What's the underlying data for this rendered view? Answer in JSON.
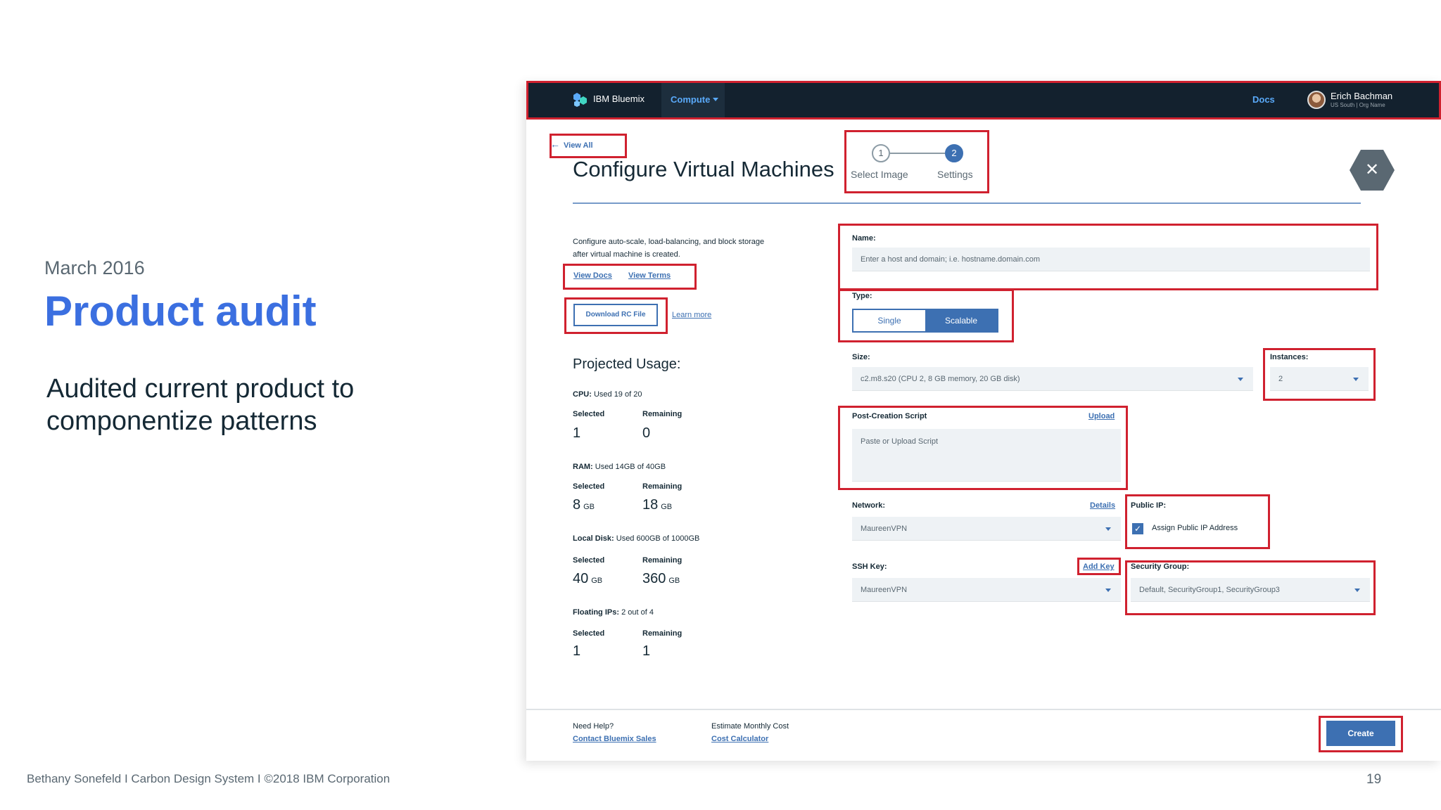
{
  "slide": {
    "date": "March 2016",
    "title": "Product audit",
    "description": "Audited current product to componentize patterns",
    "footer": "Bethany Sonefeld  I  Carbon Design System I  ©2018 IBM Corporation",
    "page_number": "19"
  },
  "topnav": {
    "brand": "IBM Bluemix",
    "menu": "Compute",
    "docs": "Docs",
    "user_name": "Erich Bachman",
    "user_sub": "US South | Org Name"
  },
  "page": {
    "view_all": "View All",
    "title": "Configure Virtual Machines",
    "steps": [
      {
        "number": "1",
        "label": "Select Image"
      },
      {
        "number": "2",
        "label": "Settings"
      }
    ],
    "close_icon": "close-icon"
  },
  "left_panel": {
    "intro": "Configure auto-scale, load-balancing, and block storage after virtual machine is created.",
    "view_docs": "View Docs",
    "view_terms": "View Terms",
    "download_rc": "Download RC File",
    "learn_more": "Learn more",
    "usage_title": "Projected Usage:",
    "col_selected": "Selected",
    "col_remaining": "Remaining",
    "cpu": {
      "label": "CPU:",
      "detail": "Used 19 of 20",
      "selected": "1",
      "remaining": "0",
      "unit": ""
    },
    "ram": {
      "label": "RAM:",
      "detail": "Used 14GB of 40GB",
      "selected": "8",
      "remaining": "18",
      "unit": "GB"
    },
    "disk": {
      "label": "Local Disk:",
      "detail": "Used 600GB of 1000GB",
      "selected": "40",
      "remaining": "360",
      "unit": "GB"
    },
    "ips": {
      "label": "Floating IPs:",
      "detail": "2 out of 4",
      "selected": "1",
      "remaining": "1",
      "unit": ""
    }
  },
  "form": {
    "name_label": "Name:",
    "name_placeholder": "Enter a host and domain; i.e. hostname.domain.com",
    "type_label": "Type:",
    "type_options": [
      "Single",
      "Scalable"
    ],
    "type_selected": "Scalable",
    "size_label": "Size:",
    "size_value": "c2.m8.s20 (CPU 2, 8 GB memory, 20 GB disk)",
    "instances_label": "Instances:",
    "instances_value": "2",
    "script_label": "Post-Creation Script",
    "script_upload": "Upload",
    "script_placeholder": "Paste or Upload Script",
    "network_label": "Network:",
    "network_details": "Details",
    "network_value": "MaureenVPN",
    "public_ip_label": "Public IP:",
    "public_ip_checkbox": "Assign Public IP Address",
    "ssh_label": "SSH Key:",
    "ssh_add": "Add Key",
    "ssh_value": "MaureenVPN",
    "security_label": "Security Group:",
    "security_value": "Default, SecurityGroup1, SecurityGroup3"
  },
  "bottom": {
    "help_label": "Need Help?",
    "help_link": "Contact Bluemix Sales",
    "cost_label": "Estimate Monthly Cost",
    "cost_link": "Cost Calculator",
    "create": "Create"
  }
}
